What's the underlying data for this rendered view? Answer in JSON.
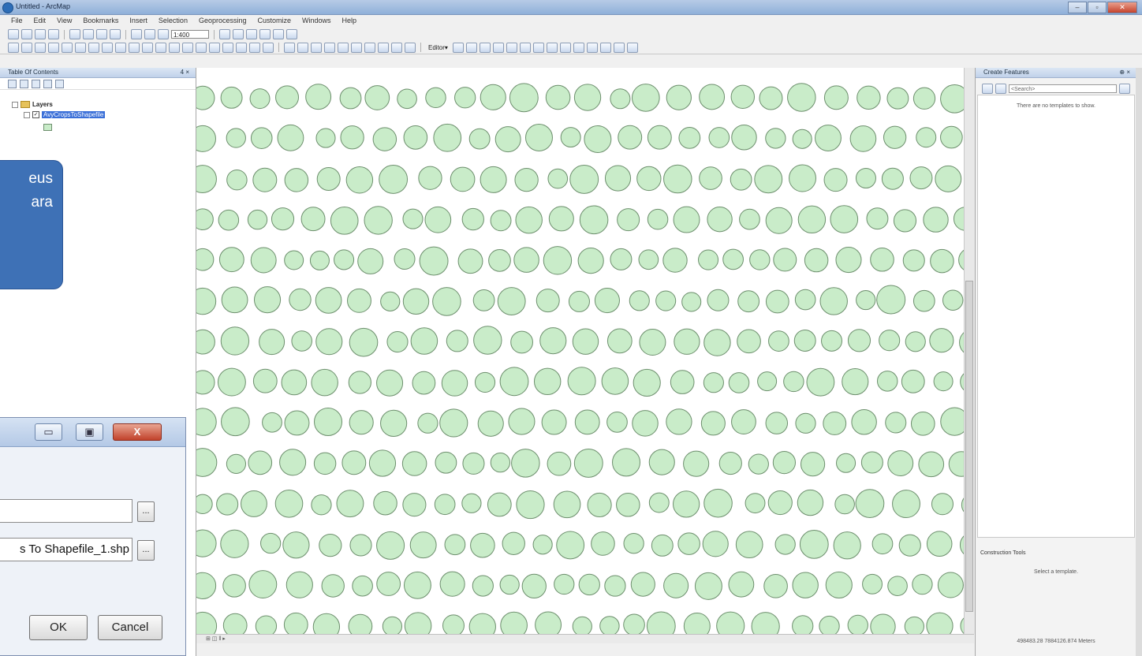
{
  "window": {
    "title": "Untitled - ArcMap",
    "buttons": {
      "minimize": "–",
      "maximize": "▫",
      "close": "✕"
    }
  },
  "menu": [
    "File",
    "Edit",
    "View",
    "Bookmarks",
    "Insert",
    "Selection",
    "Geoprocessing",
    "Customize",
    "Windows",
    "Help"
  ],
  "toolbar": {
    "scale": "1:400",
    "editor_label": "Editor▾"
  },
  "toc": {
    "title": "Table Of Contents",
    "pin": "4 ×",
    "layers_label": "Layers",
    "layer_name": "AvyCropsToShapefile",
    "layer_checked": true
  },
  "callout": {
    "line1": "eus",
    "line2": "ara"
  },
  "map": {
    "feature_fill": "#c9ecc9",
    "feature_stroke": "#6d8f6d",
    "status": "⊞ ◫ ‖ ▸"
  },
  "create_features": {
    "title": "Create Features",
    "pin": "⊕ ×",
    "search_placeholder": "<Search>",
    "empty_message": "There are no templates to show.",
    "construction_tools": "Construction Tools",
    "select_template": "Select a template.",
    "coordinates": "498483.28  7884126.874 Meters"
  },
  "dialog": {
    "minimize": "▭",
    "maximize": "▣",
    "close": "X",
    "input_value": "",
    "output_value": "s To Shapefile_1.shp",
    "browse": "...",
    "ok": "OK",
    "cancel": "Cancel"
  }
}
